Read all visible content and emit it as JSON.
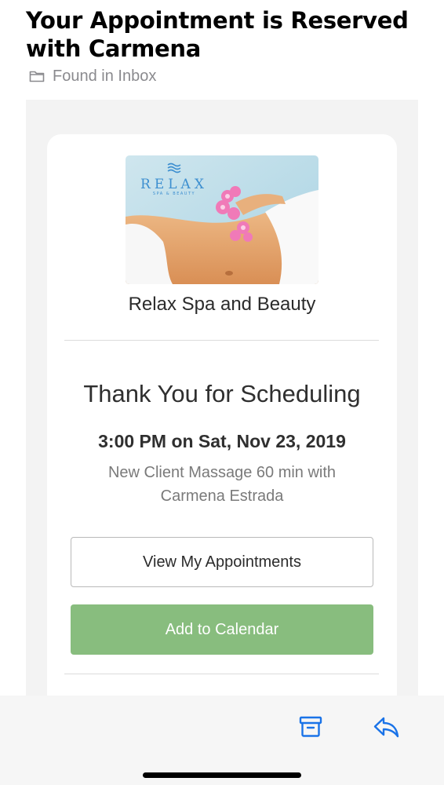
{
  "mail": {
    "subject": "Your Appointment is Reserved with Carmena",
    "mailbox_label": "Found in Inbox"
  },
  "email": {
    "logo": {
      "brand": "RELAX",
      "tagline": "SPA & BEAUTY"
    },
    "business_name": "Relax Spa and Beauty",
    "heading": "Thank You for Scheduling",
    "appointment_time": "3:00 PM on Sat, Nov 23, 2019",
    "appointment_description": "New Client Massage 60 min with Carmena Estrada",
    "view_button_label": "View My Appointments",
    "add_button_label": "Add to Calendar"
  },
  "toolbar": {
    "archive_icon": "archive-icon",
    "reply_icon": "reply-icon"
  },
  "colors": {
    "accent_blue": "#1a73e8",
    "calendar_button_green": "#88bd7e"
  }
}
